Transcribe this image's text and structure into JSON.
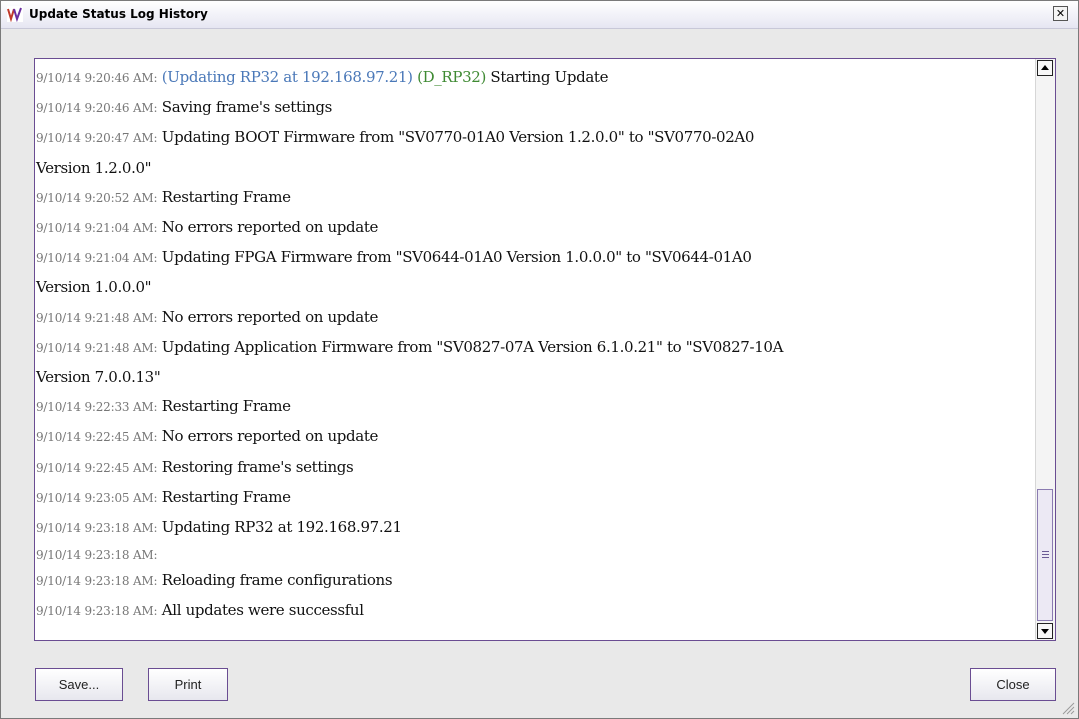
{
  "window": {
    "title": "Update Status Log History",
    "close_glyph": "✕"
  },
  "colors": {
    "accent": "#6a4d92",
    "timestamp": "#777777",
    "link_blue": "#4a78b8",
    "device_green": "#3f8a33"
  },
  "log": [
    {
      "ts": "9/10/14 9:20:46 AM:",
      "prefix_blue": "(Updating RP32 at 192.168.97.21)",
      "prefix_green": "(D_RP32)",
      "msg": "Starting Update"
    },
    {
      "ts": "9/10/14 9:20:46 AM:",
      "msg": "Saving frame's settings"
    },
    {
      "ts": "9/10/14 9:20:47 AM:",
      "msg": "Updating BOOT Firmware from \"SV0770-01A0 Version 1.2.0.0\" to \"SV0770-02A0",
      "cont": "Version 1.2.0.0\""
    },
    {
      "ts": "9/10/14 9:20:52 AM:",
      "msg": "Restarting Frame"
    },
    {
      "ts": "9/10/14 9:21:04 AM:",
      "msg": "No errors reported on update"
    },
    {
      "ts": "9/10/14 9:21:04 AM:",
      "msg": "Updating FPGA Firmware from \"SV0644-01A0 Version 1.0.0.0\" to \"SV0644-01A0",
      "cont": "Version 1.0.0.0\""
    },
    {
      "ts": "9/10/14 9:21:48 AM:",
      "msg": "No errors reported on update"
    },
    {
      "ts": "9/10/14 9:21:48 AM:",
      "msg": "Updating Application Firmware from \"SV0827-07A Version 6.1.0.21\" to \"SV0827-10A",
      "cont": "Version 7.0.0.13\""
    },
    {
      "ts": "9/10/14 9:22:33 AM:",
      "msg": "Restarting Frame"
    },
    {
      "ts": "9/10/14 9:22:45 AM:",
      "msg": "No errors reported on update"
    },
    {
      "ts": "9/10/14 9:22:45 AM:",
      "msg": "Restoring frame's settings"
    },
    {
      "ts": "9/10/14 9:23:05 AM:",
      "msg": "Restarting Frame"
    },
    {
      "ts": "9/10/14 9:23:18 AM:",
      "msg": "Updating RP32 at 192.168.97.21"
    },
    {
      "ts": "9/10/14 9:23:18 AM:",
      "msg": ""
    },
    {
      "ts": "9/10/14 9:23:18 AM:",
      "msg": "Reloading frame configurations"
    },
    {
      "ts": "9/10/14 9:23:18 AM:",
      "msg": "All updates were successful"
    }
  ],
  "buttons": {
    "save": "Save...",
    "print": "Print",
    "close": "Close"
  },
  "icons": {
    "app": "app-logo-icon",
    "scroll_up": "scroll-up-arrow-icon",
    "scroll_down": "scroll-down-arrow-icon",
    "resize": "resize-grip-icon"
  }
}
